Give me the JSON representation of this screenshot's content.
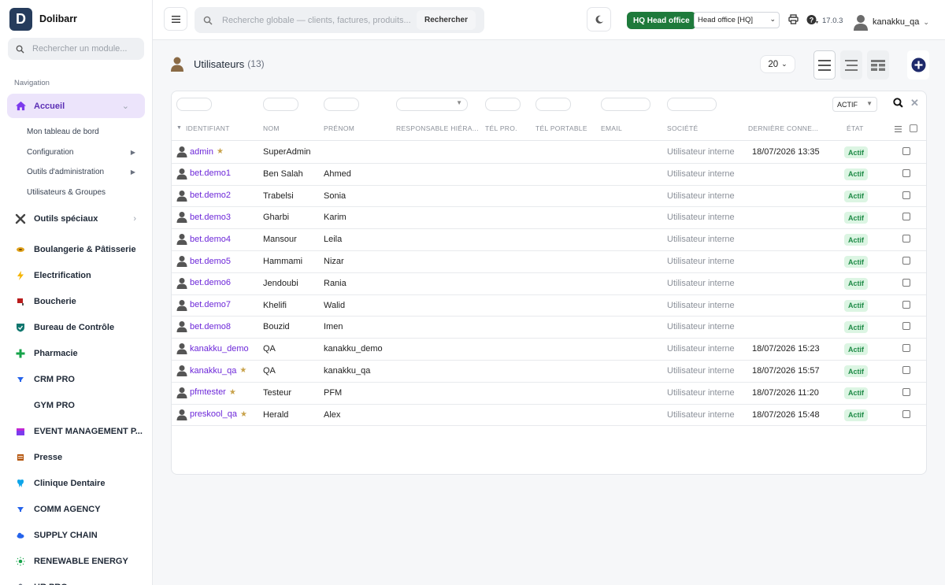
{
  "brand": {
    "name": "Dolibarr",
    "logo_letter": "D"
  },
  "sidebar": {
    "search_placeholder": "Rechercher un module...",
    "nav_title": "Navigation",
    "home": {
      "label": "Accueil",
      "icon": "home-icon"
    },
    "home_sub": [
      {
        "label": "Mon tableau de bord",
        "has_arrow": false
      },
      {
        "label": "Configuration",
        "has_arrow": true
      },
      {
        "label": "Outils d'administration",
        "has_arrow": true
      },
      {
        "label": "Utilisateurs & Groupes",
        "has_arrow": false
      }
    ],
    "tools": {
      "label": "Outils spéciaux"
    },
    "modules": [
      {
        "label": "Boulangerie & Pâtisserie",
        "icon": "bread-icon",
        "color": "#e0a21c"
      },
      {
        "label": "Electrification",
        "icon": "lightning-icon",
        "color": "#f5b400"
      },
      {
        "label": "Boucherie",
        "icon": "meat-icon",
        "color": "#b91c1c"
      },
      {
        "label": "Bureau de Contrôle",
        "icon": "shield-icon",
        "color": "#0f766e"
      },
      {
        "label": "Pharmacie",
        "icon": "cross-icon",
        "color": "#16a34a"
      },
      {
        "label": "CRM PRO",
        "icon": "funnel-icon",
        "color": "#2563eb"
      },
      {
        "label": "GYM PRO",
        "icon": "dumbbell-icon",
        "color": "#ffffff"
      },
      {
        "label": "EVENT MANAGEMENT P...",
        "icon": "calendar-icon",
        "color": "#7c3aed"
      },
      {
        "label": "Presse",
        "icon": "newspaper-icon",
        "color": "#b45309"
      },
      {
        "label": "Clinique Dentaire",
        "icon": "tooth-icon",
        "color": "#0ea5e9"
      },
      {
        "label": "COMM AGENCY",
        "icon": "funnel-icon",
        "color": "#2563eb"
      },
      {
        "label": "SUPPLY CHAIN",
        "icon": "cloud-icon",
        "color": "#2563eb"
      },
      {
        "label": "RENEWABLE ENERGY",
        "icon": "sun-icon",
        "color": "#16a34a"
      },
      {
        "label": "HR PRO",
        "icon": "people-icon",
        "color": "#6b7280"
      }
    ]
  },
  "topbar": {
    "search_placeholder": "Recherche globale — clients, factures, produits...",
    "search_button": "Rechercher",
    "hq_badge": "HQ Head office",
    "entity": "Head office [HQ]",
    "version": "17.0.3",
    "username": "kanakku_qa"
  },
  "page": {
    "title": "Utilisateurs",
    "count": "(13)",
    "limit": "20",
    "status_filter": "ACTIF"
  },
  "columns": [
    "IDENTIFIANT",
    "NOM",
    "PRÉNOM",
    "RESPONSABLE HIÉRA...",
    "TÉL PRO.",
    "TÉL PORTABLE",
    "EMAIL",
    "SOCIÉTÉ",
    "DERNIÈRE CONNE...",
    "ÉTAT"
  ],
  "rows": [
    {
      "login": "admin",
      "star": true,
      "nom": "SuperAdmin",
      "prenom": "",
      "societe": "Utilisateur interne",
      "last": "18/07/2026 13:35",
      "etat": "Actif"
    },
    {
      "login": "bet.demo1",
      "star": false,
      "nom": "Ben Salah",
      "prenom": "Ahmed",
      "societe": "Utilisateur interne",
      "last": "",
      "etat": "Actif"
    },
    {
      "login": "bet.demo2",
      "star": false,
      "nom": "Trabelsi",
      "prenom": "Sonia",
      "societe": "Utilisateur interne",
      "last": "",
      "etat": "Actif"
    },
    {
      "login": "bet.demo3",
      "star": false,
      "nom": "Gharbi",
      "prenom": "Karim",
      "societe": "Utilisateur interne",
      "last": "",
      "etat": "Actif"
    },
    {
      "login": "bet.demo4",
      "star": false,
      "nom": "Mansour",
      "prenom": "Leila",
      "societe": "Utilisateur interne",
      "last": "",
      "etat": "Actif"
    },
    {
      "login": "bet.demo5",
      "star": false,
      "nom": "Hammami",
      "prenom": "Nizar",
      "societe": "Utilisateur interne",
      "last": "",
      "etat": "Actif"
    },
    {
      "login": "bet.demo6",
      "star": false,
      "nom": "Jendoubi",
      "prenom": "Rania",
      "societe": "Utilisateur interne",
      "last": "",
      "etat": "Actif"
    },
    {
      "login": "bet.demo7",
      "star": false,
      "nom": "Khelifi",
      "prenom": "Walid",
      "societe": "Utilisateur interne",
      "last": "",
      "etat": "Actif"
    },
    {
      "login": "bet.demo8",
      "star": false,
      "nom": "Bouzid",
      "prenom": "Imen",
      "societe": "Utilisateur interne",
      "last": "",
      "etat": "Actif"
    },
    {
      "login": "kanakku_demo",
      "star": false,
      "nom": "QA",
      "prenom": "kanakku_demo",
      "societe": "Utilisateur interne",
      "last": "18/07/2026 15:23",
      "etat": "Actif"
    },
    {
      "login": "kanakku_qa",
      "star": true,
      "nom": "QA",
      "prenom": "kanakku_qa",
      "societe": "Utilisateur interne",
      "last": "18/07/2026 15:57",
      "etat": "Actif"
    },
    {
      "login": "pfmtester",
      "star": true,
      "nom": "Testeur",
      "prenom": "PFM",
      "societe": "Utilisateur interne",
      "last": "18/07/2026 11:20",
      "etat": "Actif"
    },
    {
      "login": "preskool_qa",
      "star": true,
      "nom": "Herald",
      "prenom": "Alex",
      "societe": "Utilisateur interne",
      "last": "18/07/2026 15:48",
      "etat": "Actif"
    }
  ]
}
